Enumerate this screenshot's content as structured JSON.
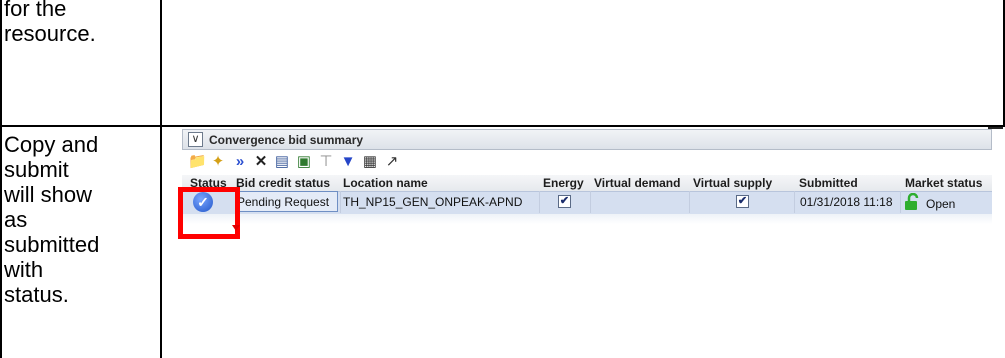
{
  "document": {
    "top_cell_lines": [
      "for the",
      "resource."
    ],
    "bottom_cell_lines": [
      "Copy and",
      "submit",
      "will show",
      "as",
      "submitted",
      "with",
      "status."
    ]
  },
  "panel": {
    "toggle_glyph": "∨",
    "title": "Convergence bid summary"
  },
  "toolbar": {
    "icons": [
      "new-bid-icon",
      "wizard-icon",
      "submit-icon",
      "delete-icon",
      "copy-icon",
      "export-icon",
      "clear-icon",
      "filter-icon",
      "columns-icon",
      "popout-icon"
    ]
  },
  "grid": {
    "columns": [
      "Status",
      "Bid credit status",
      "Location name",
      "Energy",
      "Virtual demand",
      "Virtual supply",
      "Submitted",
      "Market status"
    ],
    "rows": [
      {
        "status": "✓",
        "bid_credit_status": "Pending Request",
        "location_name": "TH_NP15_GEN_ONPEAK-APND",
        "energy": true,
        "virtual_demand": false,
        "virtual_supply": true,
        "submitted": "01/31/2018 11:18",
        "market_status": "Open"
      }
    ],
    "check_glyph": "✔"
  },
  "colors": {
    "highlight": "#ff0000",
    "row_selected": "#d5dff0",
    "lock_green": "#2fae2f"
  }
}
